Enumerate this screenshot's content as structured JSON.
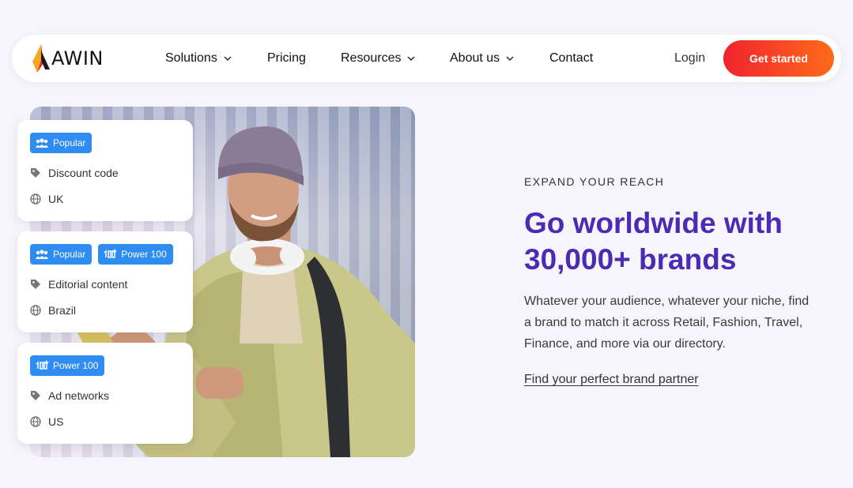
{
  "nav": {
    "logo_text": "AWIN",
    "items": [
      {
        "label": "Solutions",
        "has_dropdown": true
      },
      {
        "label": "Pricing",
        "has_dropdown": false
      },
      {
        "label": "Resources",
        "has_dropdown": true
      },
      {
        "label": "About us",
        "has_dropdown": true
      },
      {
        "label": "Contact",
        "has_dropdown": false
      }
    ],
    "login": "Login",
    "cta": "Get started"
  },
  "cards": [
    {
      "badges": [
        "Popular"
      ],
      "category": "Discount code",
      "country": "UK"
    },
    {
      "badges": [
        "Popular",
        "Power 100"
      ],
      "category": "Editorial content",
      "country": "Brazil"
    },
    {
      "badges": [
        "Power 100"
      ],
      "category": "Ad networks",
      "country": "US"
    }
  ],
  "hero": {
    "eyebrow": "EXPAND YOUR REACH",
    "headline": "Go worldwide with 30,000+ brands",
    "body": "Whatever your audience, whatever your niche, find a brand to match it across Retail, Fashion, Travel, Finance, and more via our directory.",
    "link": "Find your perfect brand partner"
  },
  "colors": {
    "accent": "#4b2bb3",
    "cta_start": "#f0232e",
    "cta_end": "#ff6b1a",
    "badge": "#2f8cf0",
    "background": "#f6f5fb"
  },
  "icons": [
    "awin-logo-icon",
    "chevron-down-icon",
    "popular-icon",
    "power100-icon",
    "tag-icon",
    "globe-icon"
  ]
}
